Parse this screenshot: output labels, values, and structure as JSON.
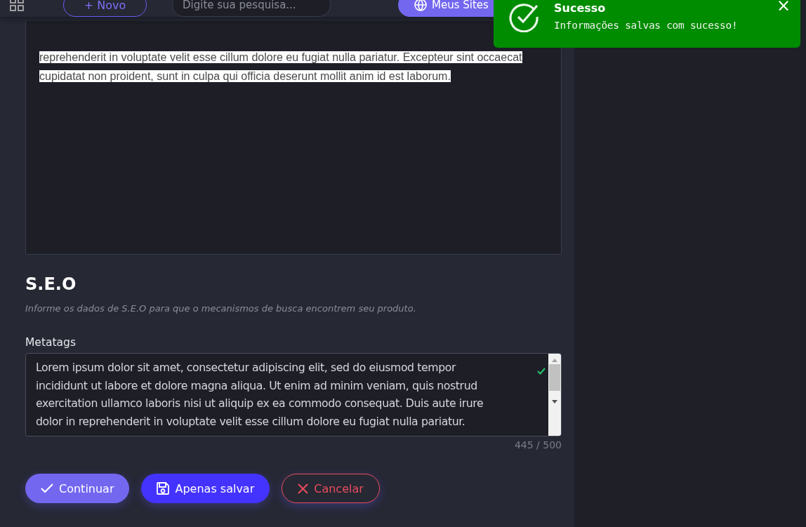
{
  "header": {
    "new_button": "+ Novo",
    "search": {
      "placeholder": "Digite sua pesquisa..."
    },
    "sites_button": "Meus Sites"
  },
  "editor": {
    "text": "reprehenderit in voluptate velit esse cillum dolore eu fugiat nulla pariatur. Excepteur sint occaecat cupidatat non proident, sunt in culpa qui officia deserunt mollit anim id est laborum.",
    "selected": true
  },
  "seo": {
    "title": "S.E.O",
    "description": "Informe os dados de S.E.O para que o mecanismos de busca encontrem seu produto.",
    "field": {
      "label": "Metatags",
      "value": "Lorem ipsum dolor sit amet, consectetur adipiscing elit, sed do eiusmod tempor incididunt ut labore et dolore magna aliqua. Ut enim ad minim veniam, quis nostrud exercitation ullamco laboris nisi ut aliquip ex ea commodo consequat. Duis aute irure dolor in reprehenderit in voluptate velit esse cillum dolore eu fugiat nulla pariatur.",
      "valid": true,
      "counter": "445 / 500"
    }
  },
  "actions": [
    {
      "kind": "primary",
      "label": "Continuar"
    },
    {
      "kind": "save",
      "label": "Apenas salvar"
    },
    {
      "kind": "cancel",
      "label": "Cancelar"
    }
  ],
  "toast": {
    "title": "Sucesso",
    "message": "Informações salvas com sucesso!",
    "close": "×"
  }
}
